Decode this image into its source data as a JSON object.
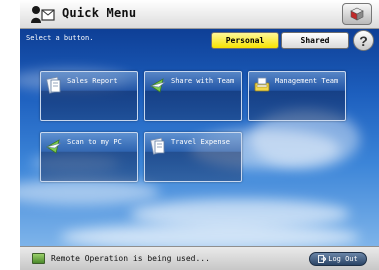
{
  "header": {
    "title": "Quick Menu",
    "menu_icon": "menu-cube-icon"
  },
  "toolbar": {
    "instruction": "Select a button.",
    "tabs": [
      {
        "label": "Personal",
        "selected": true
      },
      {
        "label": "Shared",
        "selected": false
      }
    ],
    "help_label": "?"
  },
  "tiles": [
    {
      "label": "Sales Report",
      "icon": "document-icon"
    },
    {
      "label": "Share with Team",
      "icon": "send-icon"
    },
    {
      "label": "Management Team",
      "icon": "fax-icon"
    },
    {
      "label": "Scan to my PC",
      "icon": "send-icon"
    },
    {
      "label": "Travel Expense",
      "icon": "document-icon"
    }
  ],
  "footer": {
    "status": "Remote Operation is being used...",
    "logout_label": "Log Out"
  },
  "colors": {
    "personal_active": "#f6e200",
    "sky": "#1d5fbe"
  }
}
